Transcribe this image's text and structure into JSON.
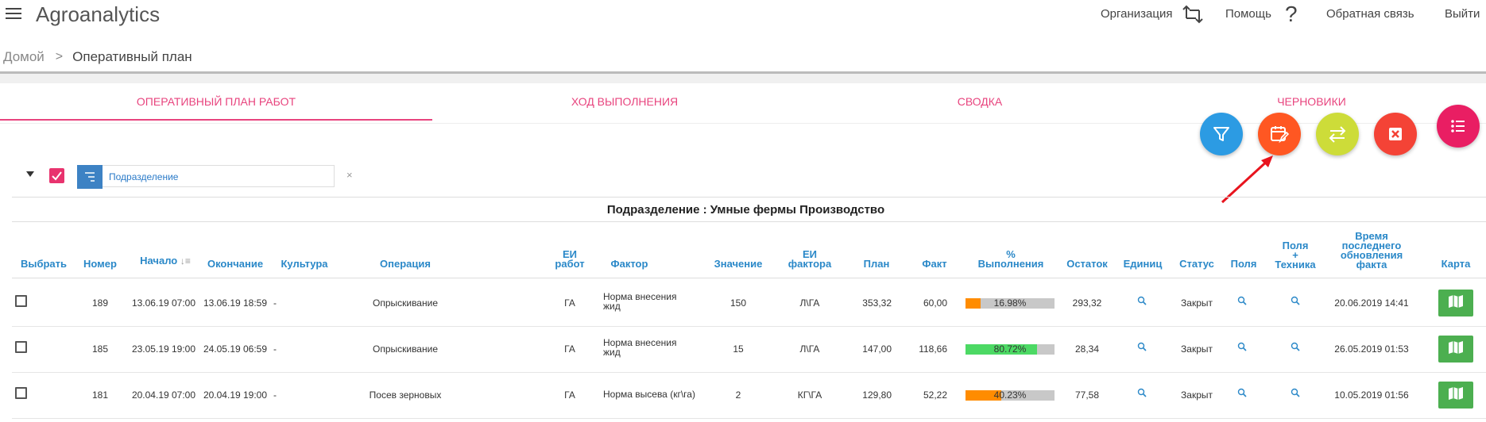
{
  "app": {
    "title": "Agroanalytics"
  },
  "top_nav": {
    "organization": "Организация",
    "help": "Помощь",
    "help_icon": "?",
    "feedback": "Обратная связь",
    "logout": "Выйти"
  },
  "breadcrumb": {
    "home": "Домой",
    "separator": ">",
    "current": "Оперативный план"
  },
  "tabs": [
    {
      "label": "Оперативный план работ",
      "active": true
    },
    {
      "label": "Ход выполнения",
      "active": false
    },
    {
      "label": "Сводка",
      "active": false
    },
    {
      "label": "Черновики",
      "active": false
    }
  ],
  "fabs": [
    {
      "name": "filter-icon",
      "color": "#2c9be3"
    },
    {
      "name": "calendar-edit-icon",
      "color": "#ff5722"
    },
    {
      "name": "swap-arrows-icon",
      "color": "#cddc39"
    },
    {
      "name": "close-square-icon",
      "color": "#f44336"
    },
    {
      "name": "list-icon",
      "color": "#e91e63"
    }
  ],
  "filter": {
    "group_field": "Подразделение",
    "remove": "×"
  },
  "group_title": "Подразделение : Умные фермы Производство",
  "table": {
    "headers": {
      "select": "Выбрать",
      "number": "Номер",
      "start": "Начало",
      "sort_icon": "↓≡",
      "end": "Окончание",
      "culture": "Культура",
      "operation": "Операция",
      "ei_work_1": "ЕИ",
      "ei_work_2": "работ",
      "factor": "Фактор",
      "value": "Значение",
      "ei_factor_1": "ЕИ",
      "ei_factor_2": "фактора",
      "plan": "План",
      "fact": "Факт",
      "pct_1": "%",
      "pct_2": "Выполнения",
      "remainder": "Остаток",
      "units": "Единиц",
      "status": "Статус",
      "fields": "Поля",
      "fields_tech_1": "Поля",
      "fields_tech_2": "+",
      "fields_tech_3": "Техника",
      "updated_1": "Время",
      "updated_2": "последнего",
      "updated_3": "обновления",
      "updated_4": "факта",
      "map": "Карта"
    },
    "rows": [
      {
        "number": "189",
        "start": "13.06.19 07:00",
        "end": "13.06.19 18:59",
        "culture": "-",
        "operation": "Опрыскивание",
        "ei_work": "ГА",
        "factor_1": "Норма внесения",
        "factor_2": "жид",
        "value": "150",
        "ei_factor": "Л\\ГА",
        "plan": "353,32",
        "fact": "60,00",
        "pct": "16.98%",
        "pct_value": 0.1698,
        "pct_color": "#ff8c00",
        "remainder": "293,32",
        "status": "Закрыт",
        "updated": "20.06.2019 14:41"
      },
      {
        "number": "185",
        "start": "23.05.19 19:00",
        "end": "24.05.19 06:59",
        "culture": "-",
        "operation": "Опрыскивание",
        "ei_work": "ГА",
        "factor_1": "Норма внесения",
        "factor_2": "жид",
        "value": "15",
        "ei_factor": "Л\\ГА",
        "plan": "147,00",
        "fact": "118,66",
        "pct": "80.72%",
        "pct_value": 0.8072,
        "pct_color": "#4cd964",
        "remainder": "28,34",
        "status": "Закрыт",
        "updated": "26.05.2019 01:53"
      },
      {
        "number": "181",
        "start": "20.04.19 07:00",
        "end": "20.04.19 19:00",
        "culture": "-",
        "operation": "Посев зерновых",
        "ei_work": "ГА",
        "factor_1": "Норма высева (кг\\га)",
        "factor_2": "",
        "value": "2",
        "ei_factor": "КГ\\ГА",
        "plan": "129,80",
        "fact": "52,22",
        "pct": "40.23%",
        "pct_value": 0.4023,
        "pct_color": "#ff8c00",
        "remainder": "77,58",
        "status": "Закрыт",
        "updated": "10.05.2019 01:56"
      }
    ]
  }
}
